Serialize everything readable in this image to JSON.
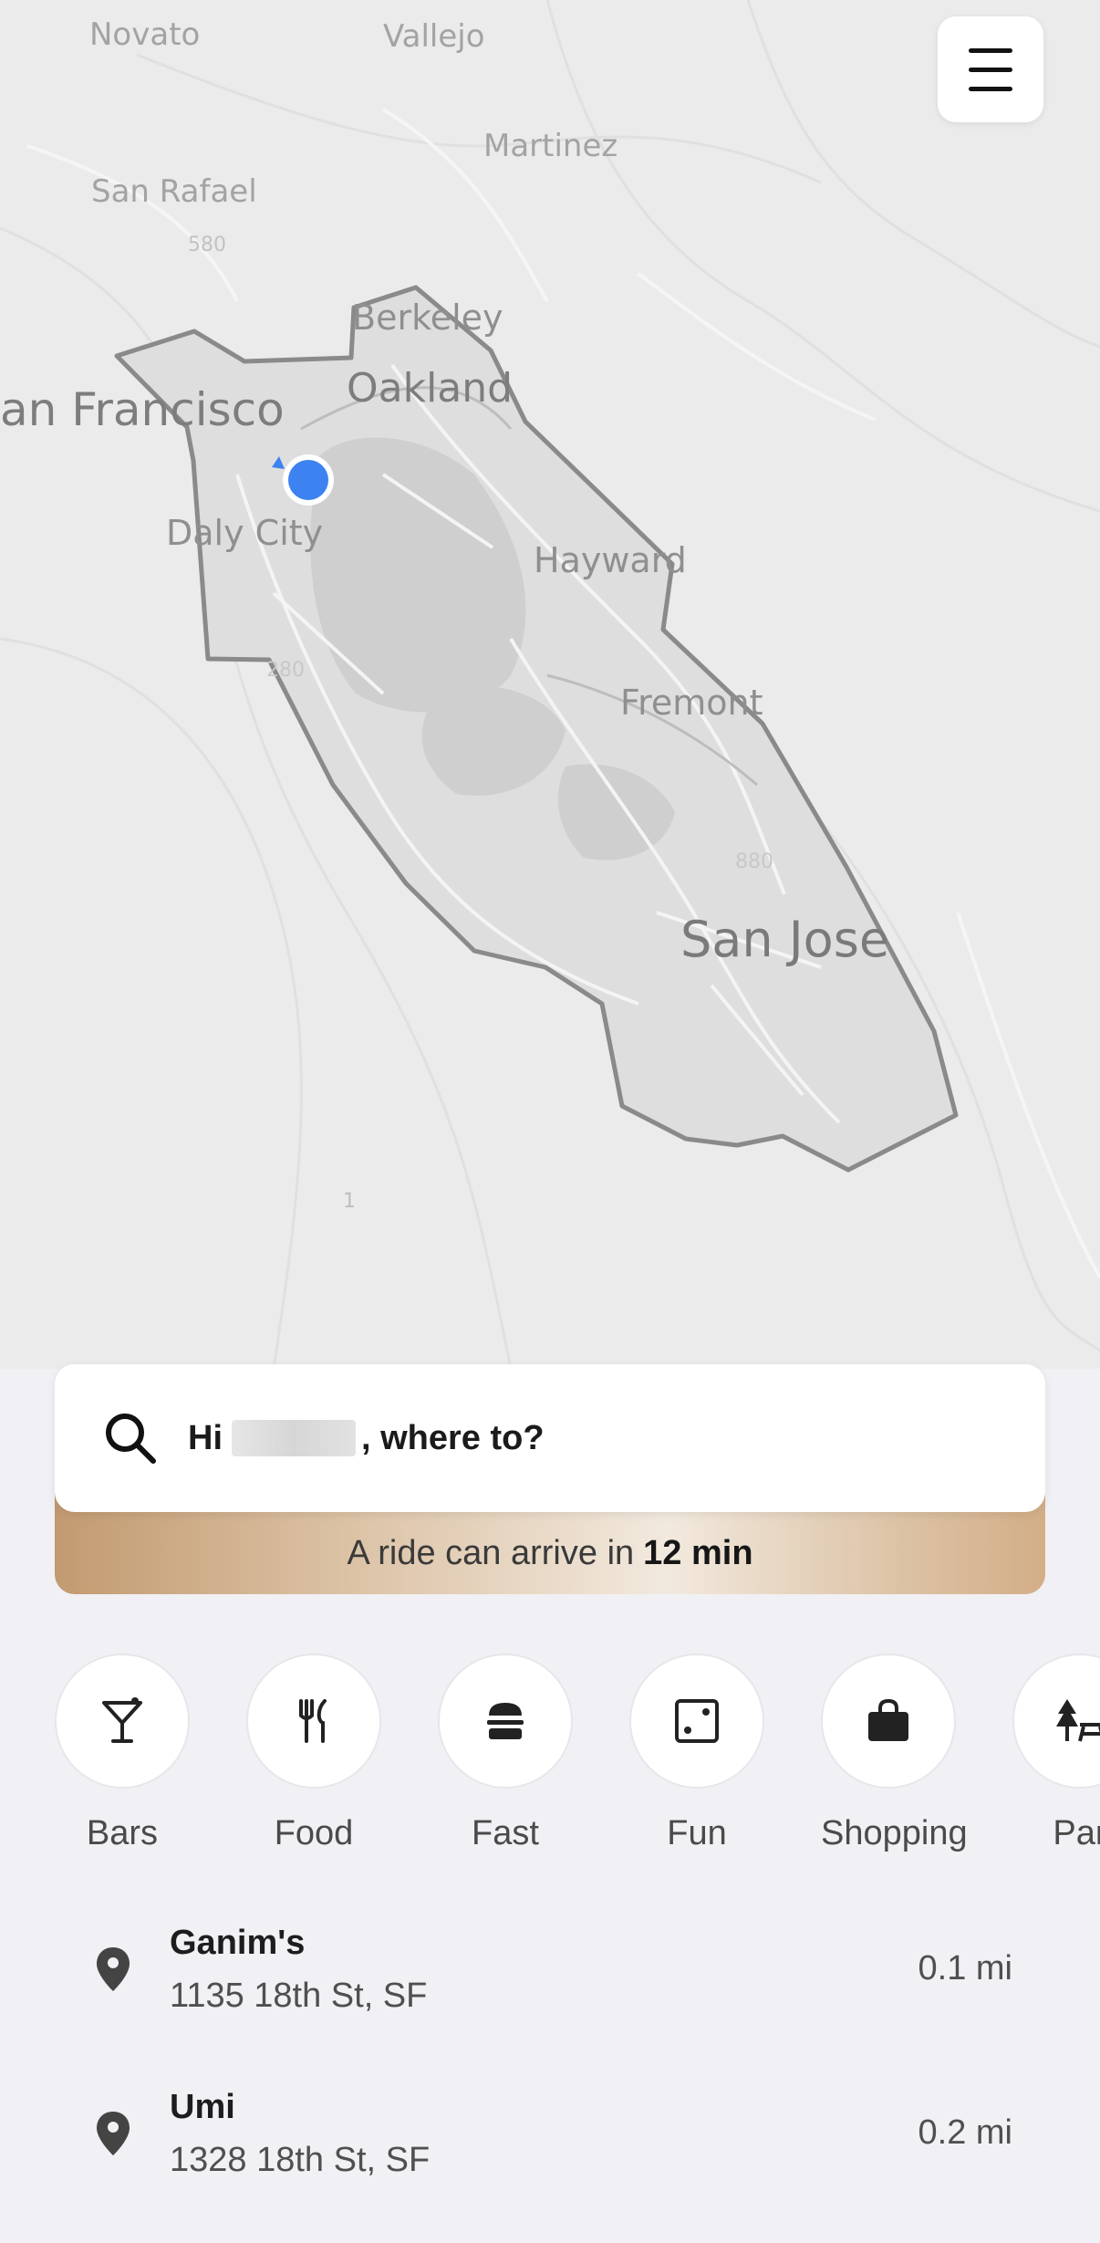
{
  "map": {
    "labels": {
      "novato": "Novato",
      "vallejo": "Vallejo",
      "martinez": "Martinez",
      "san_rafael": "San Rafael",
      "berkeley": "Berkeley",
      "oakland": "Oakland",
      "san_francisco": "an Francisco",
      "daly_city": "Daly City",
      "hayward": "Hayward",
      "fremont": "Fremont",
      "san_jose": "San Jose",
      "hw580a": "580",
      "hw880": "880",
      "hw280": "280",
      "hw1": "1"
    },
    "current_location_color": "#3c82f0",
    "service_area_outline_color": "#8a8a8a"
  },
  "menu": {
    "icon": "hamburger-menu-icon"
  },
  "search": {
    "icon": "search-icon",
    "greeting_prefix": "Hi",
    "greeting_suffix": ", where to?"
  },
  "eta": {
    "text": "A ride can arrive in",
    "time": "12 min"
  },
  "categories": [
    {
      "label": "Bars",
      "icon": "cocktail-icon"
    },
    {
      "label": "Food",
      "icon": "fork-knife-icon"
    },
    {
      "label": "Fast",
      "icon": "burger-icon"
    },
    {
      "label": "Fun",
      "icon": "dice-icon"
    },
    {
      "label": "Shopping",
      "icon": "shopping-bag-icon"
    },
    {
      "label": "Par",
      "icon": "park-icon"
    }
  ],
  "places": [
    {
      "name": "Ganim's",
      "address": "1135 18th St, SF",
      "distance": "0.1 mi"
    },
    {
      "name": "Umi",
      "address": "1328 18th St, SF",
      "distance": "0.2 mi"
    }
  ]
}
